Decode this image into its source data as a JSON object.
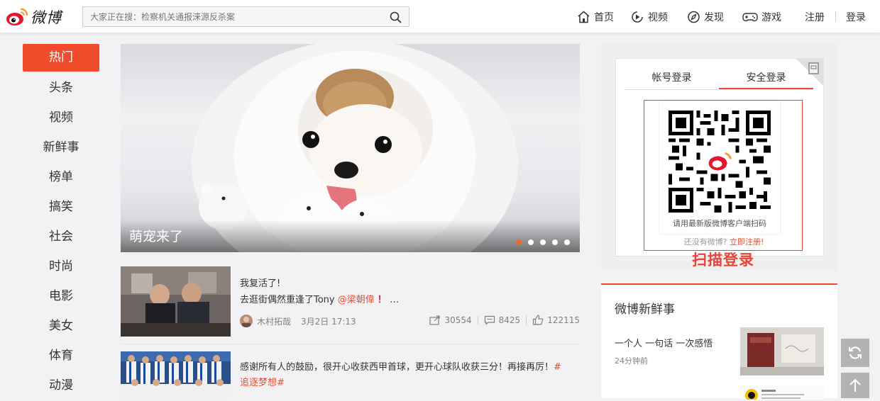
{
  "header": {
    "logo_text": "微博",
    "search_placeholder": "大家正在搜：检察机关通报涞源反杀案",
    "nav": [
      {
        "label": "首页",
        "icon": "home-icon"
      },
      {
        "label": "视频",
        "icon": "video-icon"
      },
      {
        "label": "发现",
        "icon": "compass-icon"
      },
      {
        "label": "游戏",
        "icon": "gamepad-icon"
      }
    ],
    "register": "注册",
    "login": "登录"
  },
  "sidebar": {
    "items": [
      "热门",
      "头条",
      "视频",
      "新鲜事",
      "榜单",
      "搞笑",
      "社会",
      "时尚",
      "电影",
      "美女",
      "体育",
      "动漫"
    ],
    "active_index": 0
  },
  "banner": {
    "caption": "萌宠来了",
    "dot_count": 5,
    "active_dot": 0
  },
  "feed": [
    {
      "line1": "我复活了!",
      "line2": "去逛街偶然重逢了Tony",
      "mention": "@梁朝偉",
      "exclaim": "！",
      "ellipsis": "…",
      "author": "木村拓哉",
      "time": "3月2日 17:13",
      "reposts": "30554",
      "comments": "8425",
      "likes": "122115"
    },
    {
      "text": "感谢所有人的鼓励，很开心收获西甲首球，更开心球队收获三分！再接再厉！",
      "tag_start": "#",
      "tag_end": "追逐梦想#"
    }
  ],
  "login": {
    "tab_account": "帐号登录",
    "tab_secure": "安全登录",
    "qr_hint": "请用最新版微博客户端扫码",
    "no_account": "还没有微博?",
    "register_link": "立即注册!",
    "scan_label": "扫描登录"
  },
  "news": {
    "title": "微博新鲜事",
    "headline": "一个人 一句话 一次感悟",
    "time": "24分钟前"
  },
  "colors": {
    "accent": "#f04c2b",
    "qr_border": "#e8443a"
  }
}
